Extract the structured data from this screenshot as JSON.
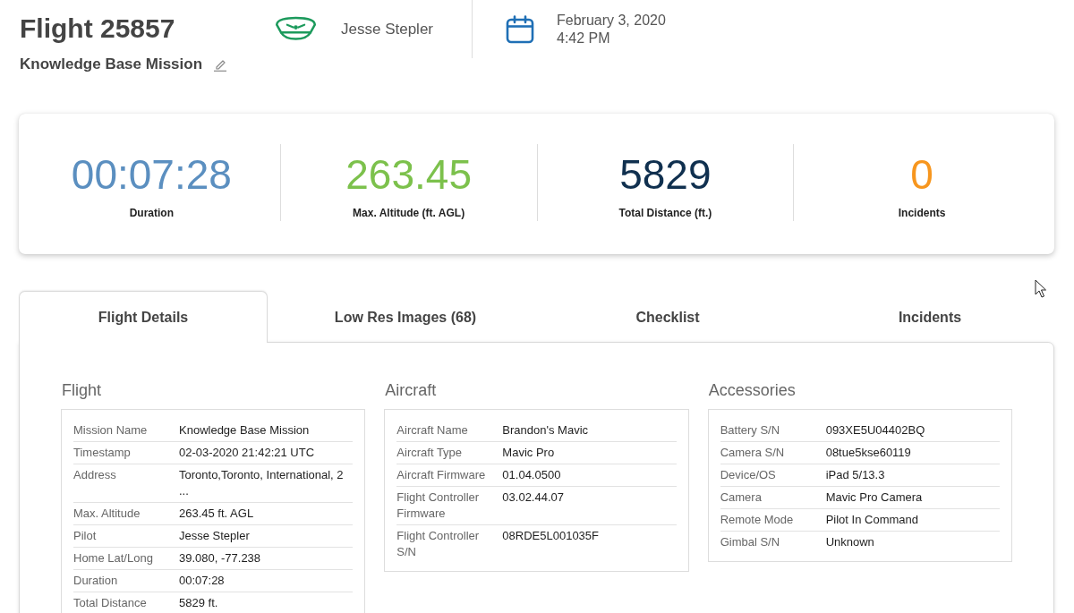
{
  "header": {
    "title": "Flight 25857",
    "mission": "Knowledge Base Mission",
    "pilot": "Jesse Stepler",
    "date": "February 3, 2020",
    "time": "4:42 PM"
  },
  "stats": [
    {
      "value": "00:07:28",
      "label": "Duration",
      "color": "#5b8fc0"
    },
    {
      "value": "263.45",
      "label": "Max. Altitude (ft. AGL)",
      "color": "#7cc14c"
    },
    {
      "value": "5829",
      "label": "Total Distance (ft.)",
      "color": "#10304f"
    },
    {
      "value": "0",
      "label": "Incidents",
      "color": "#f7961e"
    }
  ],
  "tabs": [
    {
      "label": "Flight Details",
      "selected": true
    },
    {
      "label": "Low Res Images (68)",
      "selected": false
    },
    {
      "label": "Checklist",
      "selected": false
    },
    {
      "label": "Incidents",
      "selected": false
    }
  ],
  "sections": [
    {
      "title": "Flight",
      "rows": [
        {
          "label": "Mission Name",
          "value": "Knowledge Base Mission"
        },
        {
          "label": "Timestamp",
          "value": "02-03-2020 21:42:21 UTC"
        },
        {
          "label": "Address",
          "value": "Toronto,Toronto, International, 2\n..."
        },
        {
          "label": "Max. Altitude",
          "value": "263.45 ft. AGL"
        },
        {
          "label": "Pilot",
          "value": "Jesse Stepler"
        },
        {
          "label": "Home Lat/Long",
          "value": "39.080, -77.238"
        },
        {
          "label": "Duration",
          "value": "00:07:28"
        },
        {
          "label": "Total Distance",
          "value": "5829 ft."
        }
      ]
    },
    {
      "title": "Aircraft",
      "rows": [
        {
          "label": "Aircraft Name",
          "value": "Brandon's Mavic"
        },
        {
          "label": "Aircraft Type",
          "value": "Mavic Pro"
        },
        {
          "label": "Aircraft Firmware",
          "value": "01.04.0500"
        },
        {
          "label": "Flight Controller Firmware",
          "value": "03.02.44.07"
        },
        {
          "label": "Flight Controller S/N",
          "value": "08RDE5L001035F"
        }
      ]
    },
    {
      "title": "Accessories",
      "rows": [
        {
          "label": "Battery S/N",
          "value": "093XE5U04402BQ"
        },
        {
          "label": "Camera S/N",
          "value": "08tue5kse60119"
        },
        {
          "label": "Device/OS",
          "value": "iPad 5/13.3"
        },
        {
          "label": "Camera",
          "value": "Mavic Pro Camera"
        },
        {
          "label": "Remote Mode",
          "value": "Pilot In Command"
        },
        {
          "label": "Gimbal S/N",
          "value": "Unknown"
        }
      ]
    }
  ]
}
